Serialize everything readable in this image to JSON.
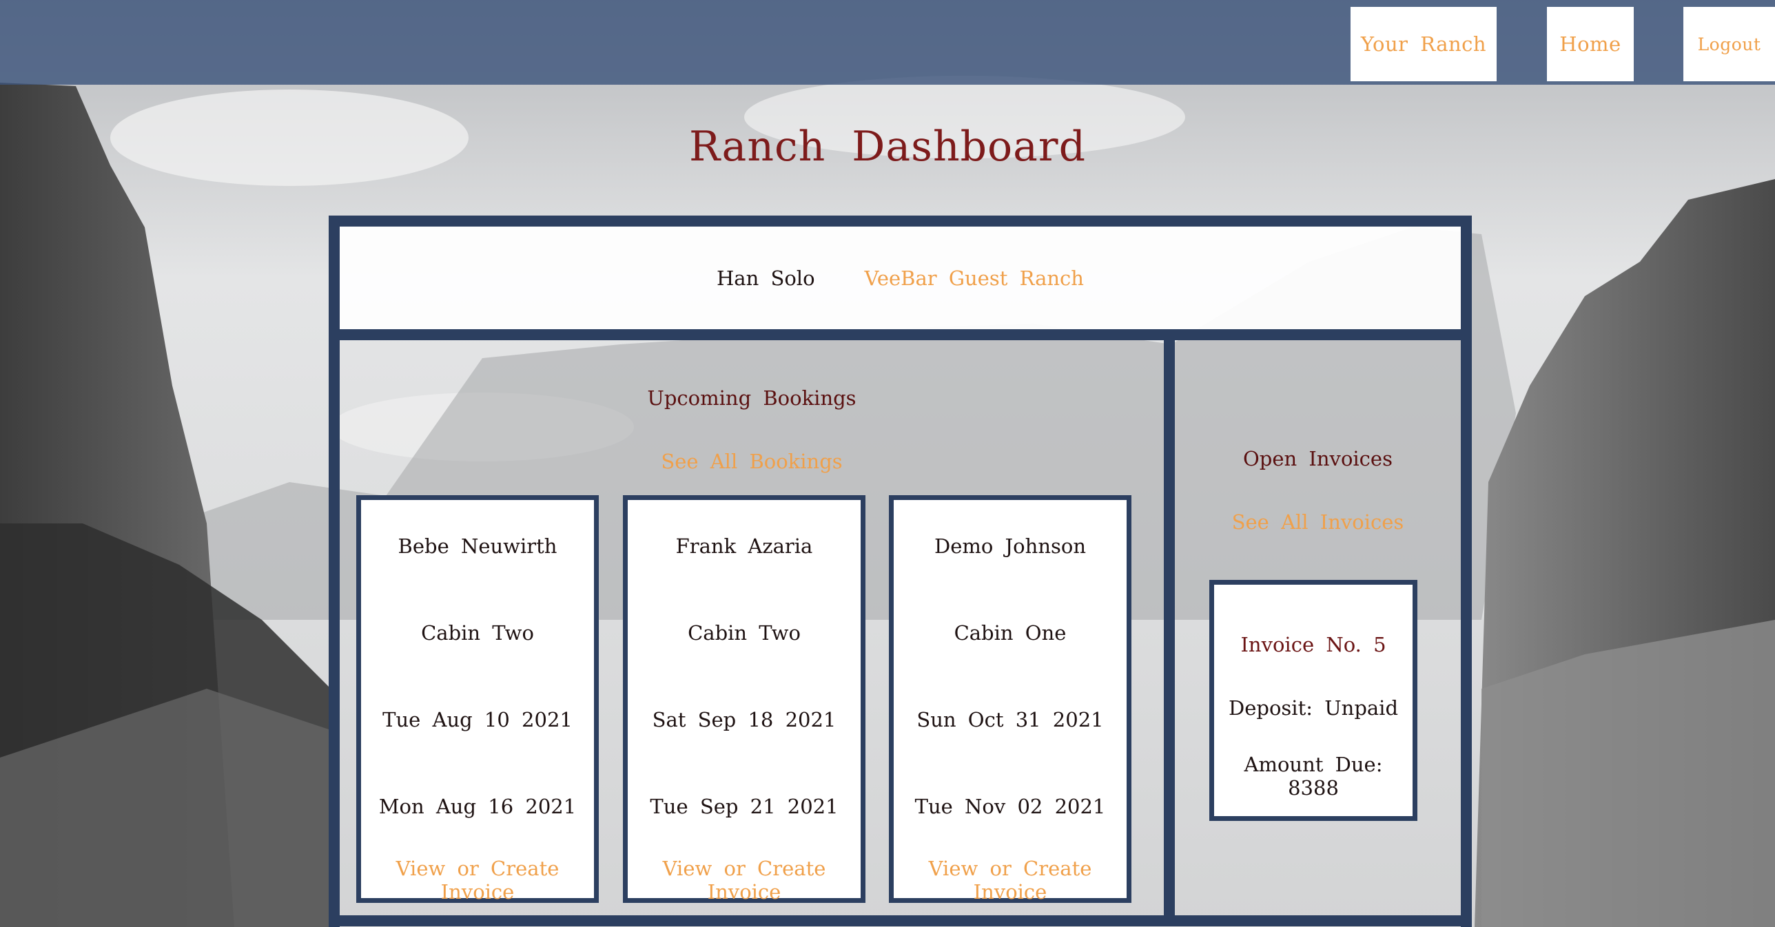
{
  "nav": {
    "your_ranch": "Your Ranch",
    "home": "Home",
    "logout": "Logout"
  },
  "page_title": "Ranch Dashboard",
  "owner": {
    "name": "Han Solo",
    "ranch": "VeeBar Guest Ranch"
  },
  "bookings": {
    "title": "Upcoming Bookings",
    "see_all": "See All Bookings",
    "items": [
      {
        "guest": "Bebe Neuwirth",
        "cabin": "Cabin Two",
        "start": "Tue Aug 10 2021",
        "end": "Mon Aug 16 2021",
        "action": "View or Create Invoice"
      },
      {
        "guest": "Frank Azaria",
        "cabin": "Cabin Two",
        "start": "Sat Sep 18 2021",
        "end": "Tue Sep 21 2021",
        "action": "View or Create Invoice"
      },
      {
        "guest": "Demo Johnson",
        "cabin": "Cabin One",
        "start": "Sun Oct 31 2021",
        "end": "Tue Nov 02 2021",
        "action": "View or Create Invoice"
      }
    ]
  },
  "invoices": {
    "title": "Open Invoices",
    "see_all": "See All Invoices",
    "items": [
      {
        "number": "Invoice No. 5",
        "deposit": "Deposit: Unpaid",
        "amount_due": "Amount Due: 8388"
      }
    ]
  },
  "colors": {
    "nav_bg": "#3e557d",
    "frame": "#2c3f60",
    "title": "#7d1b1b",
    "link": "#f0a04a"
  }
}
